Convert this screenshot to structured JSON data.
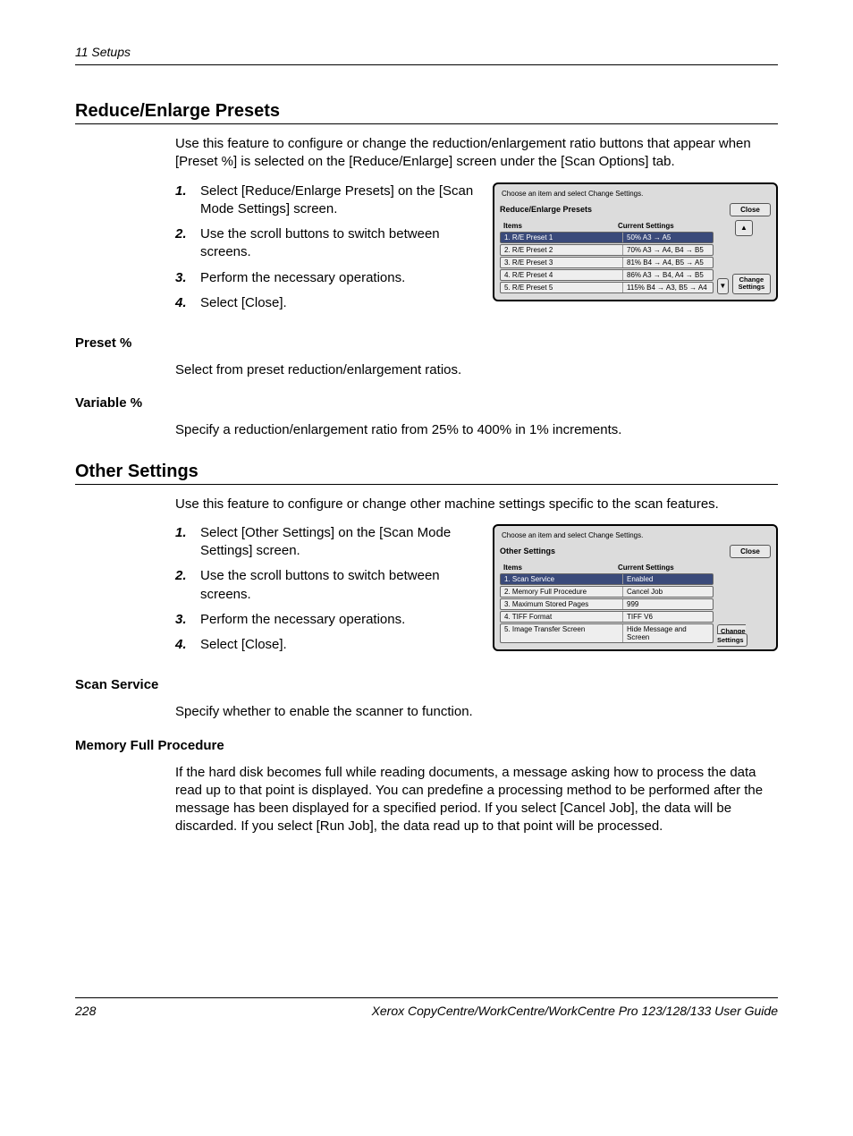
{
  "header": {
    "chapter": "11 Setups"
  },
  "section1": {
    "title": "Reduce/Enlarge Presets",
    "intro": "Use this feature to configure or change the reduction/enlargement ratio buttons that appear when [Preset %] is selected on the [Reduce/Enlarge] screen under the [Scan Options] tab.",
    "steps": [
      "Select [Reduce/Enlarge Presets] on the [Scan Mode Settings] screen.",
      "Use the scroll buttons to switch between screens.",
      "Perform the necessary operations.",
      "Select [Close]."
    ],
    "screenshot": {
      "hint": "Choose an item and select Change Settings.",
      "title": "Reduce/Enlarge Presets",
      "close": "Close",
      "col_items": "Items",
      "col_settings": "Current Settings",
      "rows": [
        {
          "item": "1. R/E Preset 1",
          "setting": "50%  A3 → A5"
        },
        {
          "item": "2. R/E Preset 2",
          "setting": "70%  A3 → A4, B4 → B5"
        },
        {
          "item": "3. R/E Preset 3",
          "setting": "81%  B4 → A4, B5 → A5"
        },
        {
          "item": "4. R/E Preset 4",
          "setting": "86%  A3 → B4, A4 → B5"
        },
        {
          "item": "5. R/E Preset 5",
          "setting": "115% B4 → A3, B5 → A4"
        }
      ],
      "change": "Change Settings"
    },
    "sub1": {
      "title": "Preset %",
      "text": "Select from preset reduction/enlargement ratios."
    },
    "sub2": {
      "title": "Variable %",
      "text": "Specify a reduction/enlargement ratio from 25% to 400% in 1% increments."
    }
  },
  "section2": {
    "title": "Other Settings",
    "intro": "Use this feature to configure or change other machine settings specific to the scan features.",
    "steps": [
      "Select [Other Settings] on the [Scan Mode Settings] screen.",
      "Use the scroll buttons to switch between screens.",
      "Perform the necessary operations.",
      "Select [Close]."
    ],
    "screenshot": {
      "hint": "Choose an item and select Change Settings.",
      "title": "Other Settings",
      "close": "Close",
      "col_items": "Items",
      "col_settings": "Current Settings",
      "rows": [
        {
          "item": "1. Scan Service",
          "setting": "Enabled"
        },
        {
          "item": "2. Memory Full Procedure",
          "setting": "Cancel Job"
        },
        {
          "item": "3. Maximum Stored Pages",
          "setting": "999"
        },
        {
          "item": "4. TIFF Format",
          "setting": "TIFF V6"
        },
        {
          "item": "5. Image Transfer Screen",
          "setting": "Hide Message and Screen"
        }
      ],
      "change": "Change Settings"
    },
    "sub1": {
      "title": "Scan Service",
      "text": "Specify whether to enable the scanner to function."
    },
    "sub2": {
      "title": "Memory Full Procedure",
      "text": "If the hard disk becomes full while reading documents, a message asking how to process the data read up to that point is displayed. You can predefine a processing method to be performed after the message has been displayed for a specified period. If you select [Cancel Job], the data will be discarded. If you select [Run Job], the data read up to that point will be processed."
    }
  },
  "footer": {
    "page": "228",
    "guide": "Xerox CopyCentre/WorkCentre/WorkCentre Pro 123/128/133 User Guide"
  }
}
